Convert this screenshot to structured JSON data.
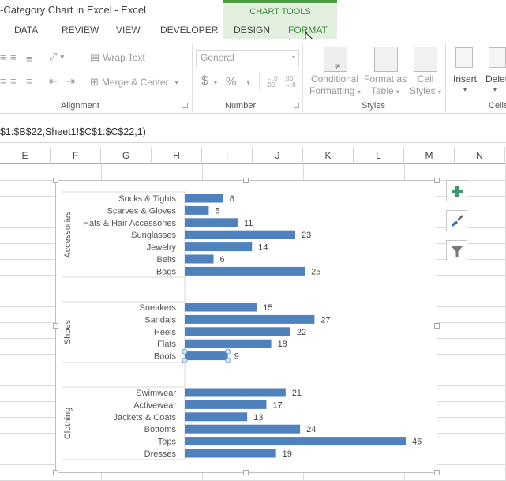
{
  "window": {
    "title": "-Category Chart in Excel - Excel"
  },
  "contextual_tab_group": {
    "label": "CHART TOOLS",
    "color": "#3a8a32"
  },
  "ribbon_tabs": [
    {
      "label": "DATA",
      "active": false
    },
    {
      "label": "REVIEW",
      "active": false
    },
    {
      "label": "VIEW",
      "active": false
    },
    {
      "label": "DEVELOPER",
      "active": false
    },
    {
      "label": "DESIGN",
      "active": false
    },
    {
      "label": "FORMAT",
      "active": true
    }
  ],
  "ribbon": {
    "alignment": {
      "wrap_text": "Wrap Text",
      "merge_center": "Merge & Center",
      "group_label": "Alignment"
    },
    "number": {
      "format_value": "General",
      "currency": "$",
      "percent": "%",
      "comma": ",",
      "inc_decimal": "←.0 .00",
      "dec_decimal": ".00 →.0",
      "group_label": "Number"
    },
    "styles": {
      "conditional_formatting": [
        "Conditional",
        "Formatting"
      ],
      "format_as_table": [
        "Format as",
        "Table"
      ],
      "cell_styles": [
        "Cell",
        "Styles"
      ],
      "group_label": "Styles"
    },
    "cells": {
      "insert": "Insert",
      "delete": "Delet",
      "group_label": "Cells"
    }
  },
  "formula_bar": {
    "text": "$1:$B$22,Sheet1!$C$1:$C$22,1)"
  },
  "columns": [
    "E",
    "F",
    "G",
    "H",
    "I",
    "J",
    "K",
    "L",
    "M",
    "N"
  ],
  "chart_tools_buttons": [
    {
      "name": "chart-elements",
      "icon": "plus-icon"
    },
    {
      "name": "chart-styles",
      "icon": "paintbrush-icon"
    },
    {
      "name": "chart-filters",
      "icon": "filter-icon"
    }
  ],
  "chart_data": {
    "type": "bar",
    "orientation": "horizontal",
    "title": "",
    "xlabel": "",
    "ylabel": "",
    "bar_color": "#4f81bd",
    "data_labels": true,
    "legend": "none",
    "grid": false,
    "xlim": [
      0,
      46
    ],
    "selected_point": "Boots",
    "groups": [
      {
        "name": "Accessories",
        "categories": [
          "Socks & Tights",
          "Scarves & Gloves",
          "Hats & Hair Accessories",
          "Sunglasses",
          "Jewelry",
          "Belts",
          "Bags"
        ],
        "values": [
          8,
          5,
          11,
          23,
          14,
          6,
          25
        ]
      },
      {
        "name": "Shoes",
        "categories": [
          "Sneakers",
          "Sandals",
          "Heels",
          "Flats",
          "Boots"
        ],
        "values": [
          15,
          27,
          22,
          18,
          9
        ]
      },
      {
        "name": "Clothing",
        "categories": [
          "Swimwear",
          "Activewear",
          "Jackets & Coats",
          "Bottoms",
          "Tops",
          "Dresses"
        ],
        "values": [
          21,
          17,
          13,
          24,
          46,
          19
        ]
      }
    ]
  }
}
